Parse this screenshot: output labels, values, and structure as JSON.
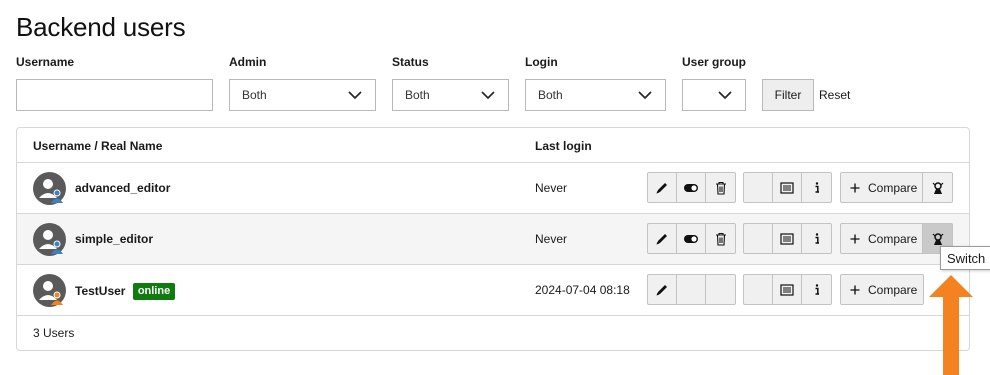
{
  "page": {
    "title": "Backend users"
  },
  "filters": {
    "username": {
      "label": "Username",
      "value": ""
    },
    "admin": {
      "label": "Admin",
      "selected": "Both"
    },
    "status": {
      "label": "Status",
      "selected": "Both"
    },
    "login": {
      "label": "Login",
      "selected": "Both"
    },
    "user_group": {
      "label": "User group",
      "selected": ""
    },
    "filter_button": "Filter",
    "reset_link": "Reset"
  },
  "table": {
    "headers": {
      "name": "Username / Real Name",
      "last_login": "Last login"
    },
    "rows": [
      {
        "username": "advanced_editor",
        "badge": "",
        "last_login": "Never",
        "compare": "Compare"
      },
      {
        "username": "simple_editor",
        "badge": "",
        "last_login": "Never",
        "compare": "Compare"
      },
      {
        "username": "TestUser",
        "badge": "online",
        "last_login": "2024-07-04 08:18",
        "compare": "Compare"
      }
    ],
    "footer": "3 Users"
  },
  "tooltip": {
    "text": "Switch"
  },
  "colors": {
    "online_badge": "#107c10",
    "arrow": "#f58220",
    "avatar_badge_blue": "#3b82c4",
    "avatar_badge_orange": "#f58220"
  },
  "icons": [
    "edit-icon",
    "toggle-icon",
    "trash-icon",
    "list-icon",
    "info-icon",
    "plus-icon",
    "switch-user-icon",
    "chevron-down-icon",
    "avatar-icon"
  ]
}
